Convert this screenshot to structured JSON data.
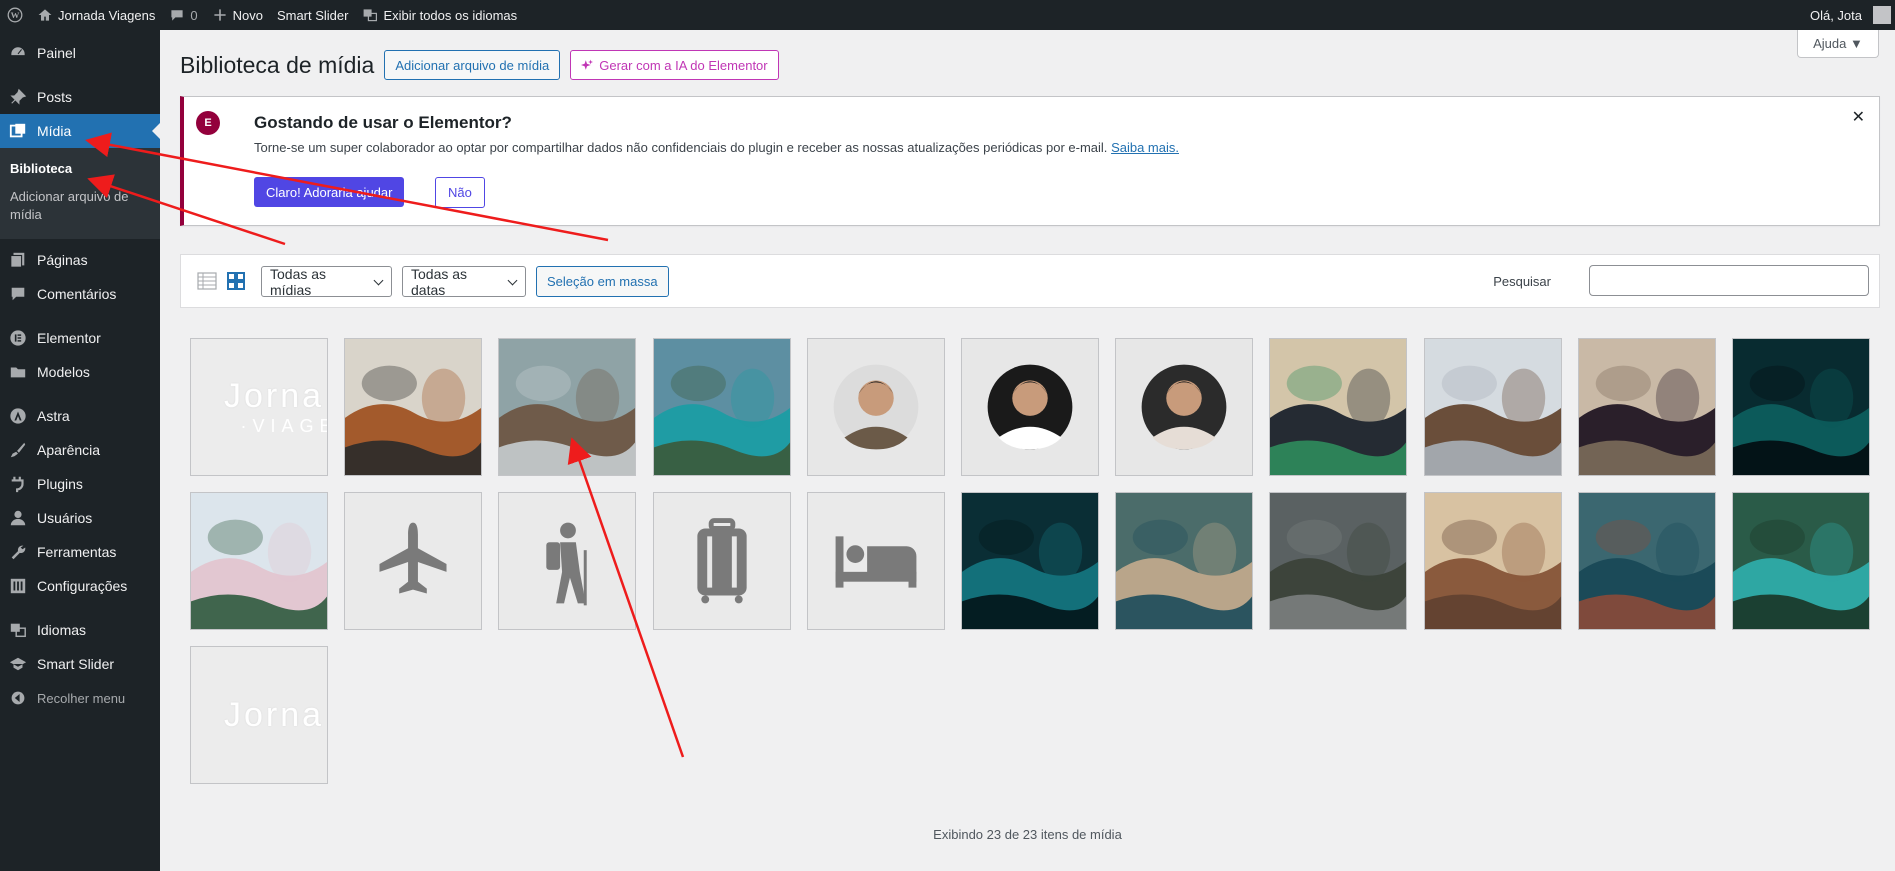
{
  "adminbar": {
    "site_name": "Jornada Viagens",
    "comments_count": "0",
    "new_label": "Novo",
    "smart_slider": "Smart Slider",
    "languages": "Exibir todos os idiomas",
    "greeting": "Olá, Jota"
  },
  "sidebar": {
    "items": [
      {
        "label": "Painel",
        "icon": "dashboard-icon"
      },
      {
        "label": "Posts",
        "icon": "pin-icon"
      },
      {
        "label": "Mídia",
        "icon": "media-icon"
      },
      {
        "label": "Páginas",
        "icon": "pages-icon"
      },
      {
        "label": "Comentários",
        "icon": "comments-icon"
      },
      {
        "label": "Elementor",
        "icon": "elementor-icon"
      },
      {
        "label": "Modelos",
        "icon": "folder-icon"
      },
      {
        "label": "Astra",
        "icon": "astra-icon"
      },
      {
        "label": "Aparência",
        "icon": "brush-icon"
      },
      {
        "label": "Plugins",
        "icon": "plugin-icon"
      },
      {
        "label": "Usuários",
        "icon": "user-icon"
      },
      {
        "label": "Ferramentas",
        "icon": "wrench-icon"
      },
      {
        "label": "Configurações",
        "icon": "settings-icon"
      },
      {
        "label": "Idiomas",
        "icon": "translate-icon"
      },
      {
        "label": "Smart Slider",
        "icon": "slider-icon"
      }
    ],
    "submenu": {
      "library": "Biblioteca",
      "add": "Adicionar arquivo de mídia"
    },
    "collapse": "Recolher menu"
  },
  "header": {
    "help": "Ajuda ▼",
    "title": "Biblioteca de mídia",
    "add_button": "Adicionar arquivo de mídia",
    "ai_button": "Gerar com a IA do Elementor"
  },
  "notice": {
    "logo_text": "E",
    "title": "Gostando de usar o Elementor?",
    "text": "Torne-se um super colaborador ao optar por compartilhar dados não confidenciais do plugin e receber as nossas atualizações periódicas por e-mail.",
    "link": "Saiba mais.",
    "yes": "Claro! Adoraria ajudar",
    "no": "Não",
    "close": "✕"
  },
  "toolbar": {
    "filter_type": "Todas as mídias",
    "filter_date": "Todas as datas",
    "bulk": "Seleção em massa",
    "search_label": "Pesquisar"
  },
  "media": [
    {
      "name": "logo-jornada",
      "kind": "logo",
      "text": "Jorna",
      "sub": "·VIAGE"
    },
    {
      "name": "map-travel",
      "kind": "photo",
      "colors": [
        "#d9d4ca",
        "#a35a2c",
        "#2a2a2a"
      ]
    },
    {
      "name": "hikers-group",
      "kind": "photo",
      "colors": [
        "#8fa3a6",
        "#6f5b4a",
        "#c7cdd0"
      ]
    },
    {
      "name": "mountain-lake",
      "kind": "photo",
      "colors": [
        "#5d8fa2",
        "#1f9ca4",
        "#3b5a3a"
      ]
    },
    {
      "name": "avatar-man-1",
      "kind": "avatar",
      "colors": [
        "#6b5a48",
        "#dcdcdc"
      ]
    },
    {
      "name": "avatar-man-2",
      "kind": "avatar",
      "colors": [
        "#ffffff",
        "#1a1a1a"
      ]
    },
    {
      "name": "avatar-woman",
      "kind": "avatar",
      "colors": [
        "#e6ddd6",
        "#2b2b2b"
      ]
    },
    {
      "name": "suitcase-top",
      "kind": "photo",
      "colors": [
        "#d3c5a9",
        "#252b33",
        "#2f8c5c"
      ]
    },
    {
      "name": "women-bridge",
      "kind": "photo",
      "colors": [
        "#d5dbe0",
        "#6a4e3a",
        "#a8b0b8"
      ]
    },
    {
      "name": "passport",
      "kind": "photo",
      "colors": [
        "#c9b9a6",
        "#2a1f2a",
        "#7b6b5a"
      ]
    },
    {
      "name": "night-city-1",
      "kind": "photo",
      "colors": [
        "#082b30",
        "#0c5a5a",
        "#020b10"
      ]
    },
    {
      "name": "castle-blossom",
      "kind": "photo",
      "colors": [
        "#dce5ec",
        "#e2c7d1",
        "#2f5a3e"
      ]
    },
    {
      "name": "airplane",
      "kind": "icon",
      "glyph": "airplane-icon"
    },
    {
      "name": "hiker",
      "kind": "icon",
      "glyph": "hiker-icon"
    },
    {
      "name": "luggage",
      "kind": "icon",
      "glyph": "luggage-icon"
    },
    {
      "name": "bed",
      "kind": "icon",
      "glyph": "bed-icon"
    },
    {
      "name": "night-city-2",
      "kind": "photo",
      "colors": [
        "#0a2e35",
        "#13707a",
        "#031418"
      ]
    },
    {
      "name": "coast-city",
      "kind": "photo",
      "colors": [
        "#4b6c6a",
        "#b9a58a",
        "#1c4b5a"
      ]
    },
    {
      "name": "machu-picchu",
      "kind": "photo",
      "colors": [
        "#5a6162",
        "#3d443b",
        "#7b8080"
      ]
    },
    {
      "name": "theatre",
      "kind": "photo",
      "colors": [
        "#d8c2a2",
        "#8a5a3d",
        "#5f4030"
      ]
    },
    {
      "name": "sea-cliff",
      "kind": "photo",
      "colors": [
        "#3b6770",
        "#1b4a58",
        "#8b4a3a"
      ]
    },
    {
      "name": "river-boat",
      "kind": "photo",
      "colors": [
        "#2a5b48",
        "#2ea7a3",
        "#1a3526"
      ]
    },
    {
      "name": "logo-jornada-2",
      "kind": "logo",
      "text": "Jorna",
      "sub": ""
    }
  ],
  "footer": {
    "count": "Exibindo 23 de 23 itens de mídia"
  },
  "colors": {
    "accent": "#2271b1",
    "elementor": "#93003c",
    "button": "#5046e4",
    "arrow": "#ee1c1c"
  }
}
